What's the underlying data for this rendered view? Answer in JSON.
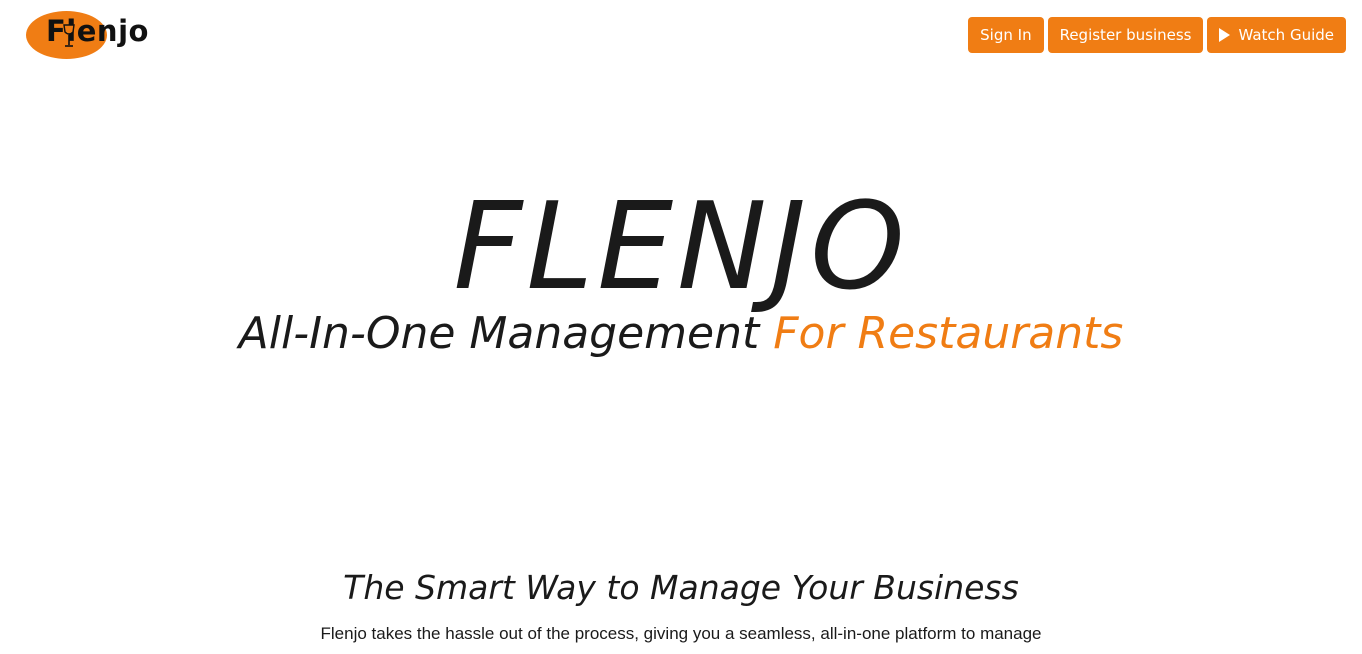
{
  "brand": {
    "logo_text": "Flenjo",
    "accent_color": "#f07d14",
    "icon": "wine-glass-icon"
  },
  "nav": {
    "sign_in": "Sign In",
    "register": "Register business",
    "watch_guide": "Watch Guide",
    "watch_icon": "play-icon"
  },
  "hero": {
    "title": "FLENJO",
    "subtitle_main": "All-In-One Management ",
    "subtitle_accent": "For Restaurants"
  },
  "section": {
    "title": "The Smart Way to Manage Your Business",
    "text": "Flenjo takes the hassle out of the process, giving you a seamless, all-in-one platform to manage"
  }
}
